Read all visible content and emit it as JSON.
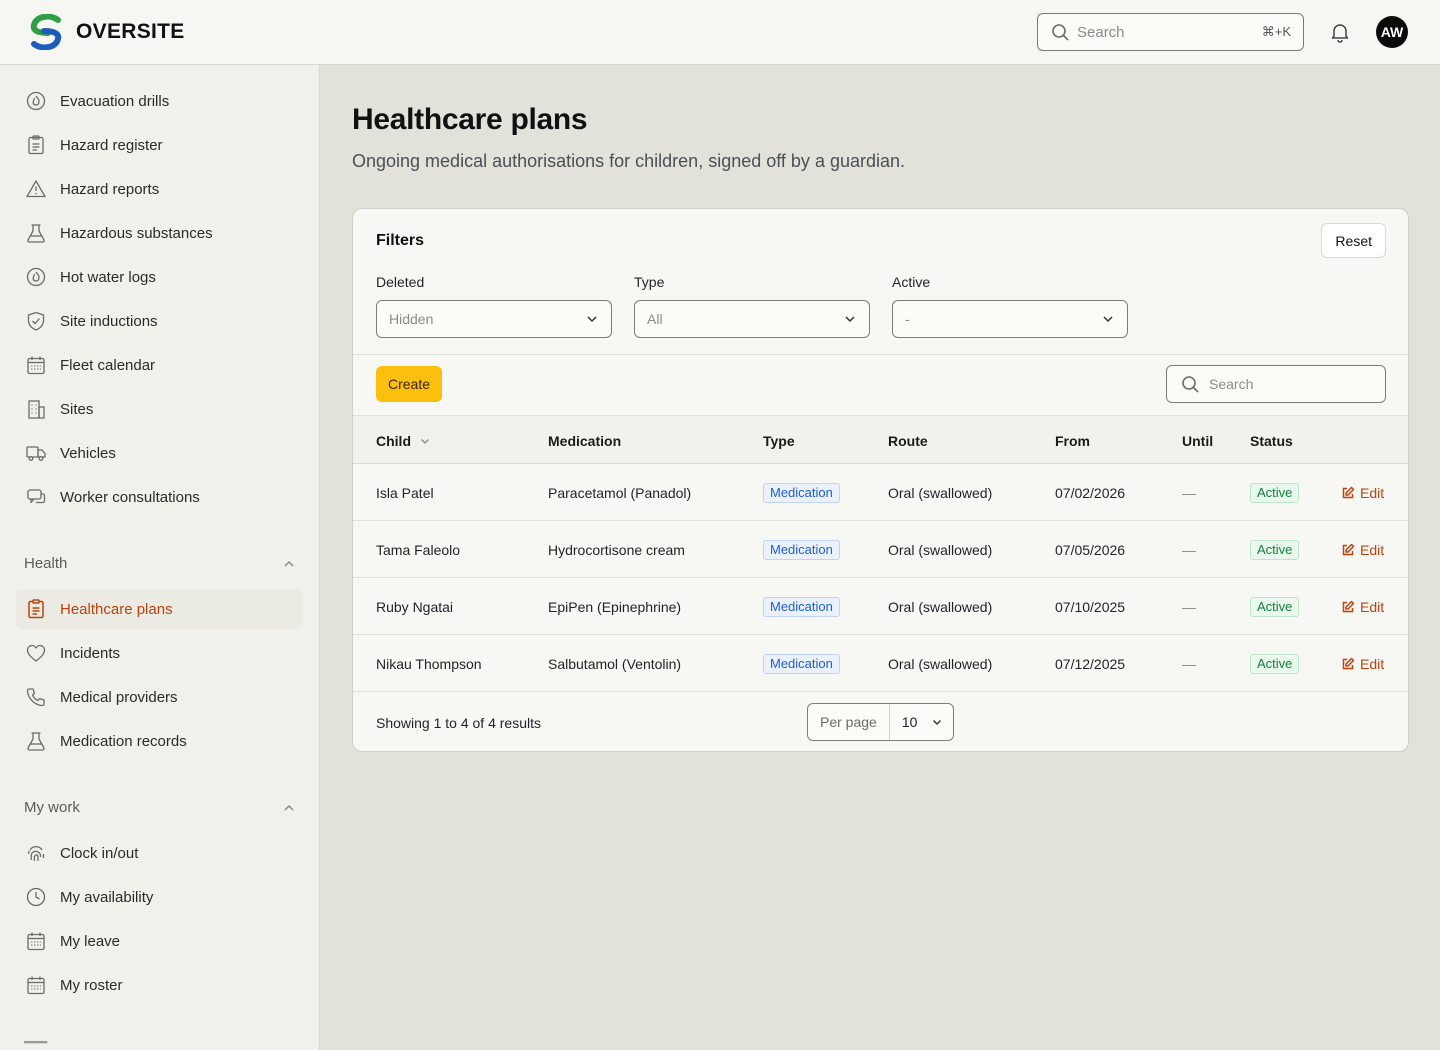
{
  "app": {
    "name": "OVERSITE",
    "avatar_initials": "AW",
    "search_placeholder": "Search",
    "search_shortcut": "⌘+K"
  },
  "sidebar": {
    "items_top": [
      {
        "label": "Evacuation drills",
        "icon": "fire-icon"
      },
      {
        "label": "Hazard register",
        "icon": "clipboard-icon"
      },
      {
        "label": "Hazard reports",
        "icon": "warning-icon"
      },
      {
        "label": "Hazardous substances",
        "icon": "flask-icon"
      },
      {
        "label": "Hot water logs",
        "icon": "fire-icon"
      },
      {
        "label": "Site inductions",
        "icon": "shield-icon"
      },
      {
        "label": "Fleet calendar",
        "icon": "calendar-icon"
      },
      {
        "label": "Sites",
        "icon": "building-icon"
      },
      {
        "label": "Vehicles",
        "icon": "truck-icon"
      },
      {
        "label": "Worker consultations",
        "icon": "chat-icon"
      }
    ],
    "health_section": "Health",
    "health_items": [
      {
        "label": "Healthcare plans",
        "icon": "clipboard-icon",
        "active": true
      },
      {
        "label": "Incidents",
        "icon": "heart-icon"
      },
      {
        "label": "Medical providers",
        "icon": "phone-icon"
      },
      {
        "label": "Medication records",
        "icon": "flask-icon"
      }
    ],
    "mywork_section": "My work",
    "mywork_items": [
      {
        "label": "Clock in/out",
        "icon": "fingerprint-icon"
      },
      {
        "label": "My availability",
        "icon": "clock-icon"
      },
      {
        "label": "My leave",
        "icon": "calendar-icon"
      },
      {
        "label": "My roster",
        "icon": "calendar-icon"
      }
    ]
  },
  "page": {
    "title": "Healthcare plans",
    "subtitle": "Ongoing medical authorisations for children, signed off by a guardian."
  },
  "filters": {
    "title": "Filters",
    "reset_label": "Reset",
    "deleted": {
      "label": "Deleted",
      "value": "Hidden"
    },
    "type": {
      "label": "Type",
      "value": "All"
    },
    "active": {
      "label": "Active",
      "value": "-"
    }
  },
  "toolbar": {
    "create_label": "Create",
    "search_placeholder": "Search"
  },
  "table": {
    "columns": {
      "child": "Child",
      "medication": "Medication",
      "type": "Type",
      "route": "Route",
      "from": "From",
      "until": "Until",
      "status": "Status"
    },
    "edit_label": "Edit",
    "rows": [
      {
        "child": "Isla Patel",
        "medication": "Paracetamol (Panadol)",
        "type": "Medication",
        "route": "Oral (swallowed)",
        "from": "07/02/2026",
        "until": "—",
        "status": "Active"
      },
      {
        "child": "Tama Faleolo",
        "medication": "Hydrocortisone cream",
        "type": "Medication",
        "route": "Oral (swallowed)",
        "from": "07/05/2026",
        "until": "—",
        "status": "Active"
      },
      {
        "child": "Ruby Ngatai",
        "medication": "EpiPen (Epinephrine)",
        "type": "Medication",
        "route": "Oral (swallowed)",
        "from": "07/10/2025",
        "until": "—",
        "status": "Active"
      },
      {
        "child": "Nikau Thompson",
        "medication": "Salbutamol (Ventolin)",
        "type": "Medication",
        "route": "Oral (swallowed)",
        "from": "07/12/2025",
        "until": "—",
        "status": "Active"
      }
    ]
  },
  "pagination": {
    "summary": "Showing 1 to 4 of 4 results",
    "per_page_label": "Per page",
    "per_page_value": "10"
  },
  "colors": {
    "accent": "#c2410c",
    "create_button": "#fbbf0e",
    "type_badge": "#1d5fd6",
    "status_badge": "#16813a"
  }
}
